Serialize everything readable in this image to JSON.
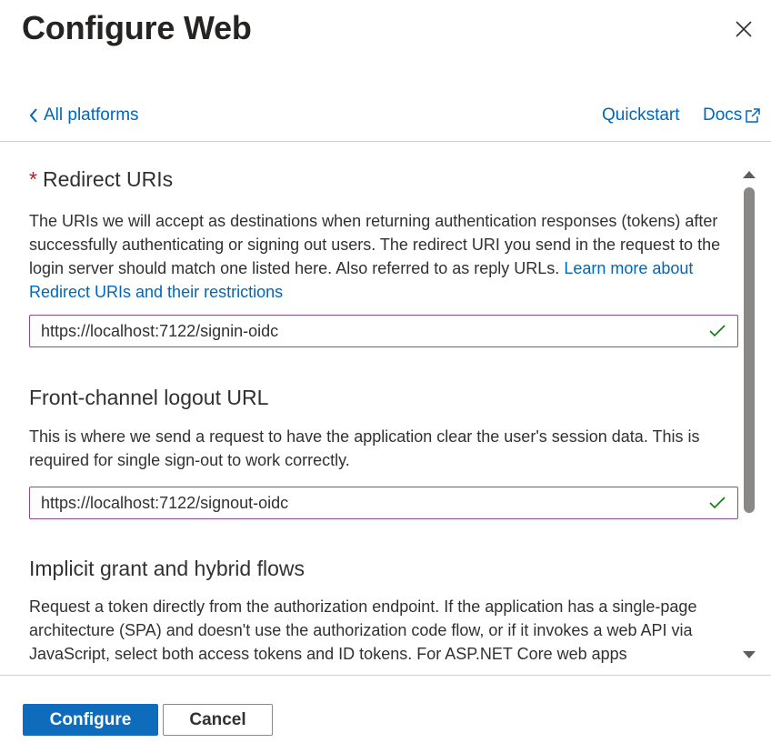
{
  "panel": {
    "title": "Configure Web"
  },
  "nav": {
    "back_label": "All platforms",
    "quickstart_label": "Quickstart",
    "docs_label": "Docs"
  },
  "redirect": {
    "required_marker": "*",
    "title": "Redirect URIs",
    "description": "The URIs we will accept as destinations when returning authentication responses (tokens) after successfully authenticating or signing out users. The redirect URI you send in the request to the login server should match one listed here. Also referred to as reply URLs.",
    "learn_more": "Learn more about Redirect URIs and their restrictions",
    "value": "https://localhost:7122/signin-oidc"
  },
  "logout": {
    "title": "Front-channel logout URL",
    "description": "This is where we send a request to have the application clear the user's session data. This is required for single sign-out to work correctly.",
    "value": "https://localhost:7122/signout-oidc"
  },
  "implicit": {
    "title": "Implicit grant and hybrid flows",
    "description": "Request a token directly from the authorization endpoint. If the application has a single-page architecture (SPA) and doesn't use the authorization code flow, or if it invokes a web API via JavaScript, select both access tokens and ID tokens. For ASP.NET Core web apps"
  },
  "footer": {
    "configure_label": "Configure",
    "cancel_label": "Cancel"
  },
  "colors": {
    "accent": "#0f6cbd",
    "link": "#0067b8",
    "required": "#a4262c",
    "valid_check": "#107c10",
    "input_border": "#8a4b9a"
  },
  "icons": {
    "close": "close-icon",
    "back": "chevron-left-icon",
    "docs": "external-link-icon",
    "valid": "checkmark-icon"
  }
}
